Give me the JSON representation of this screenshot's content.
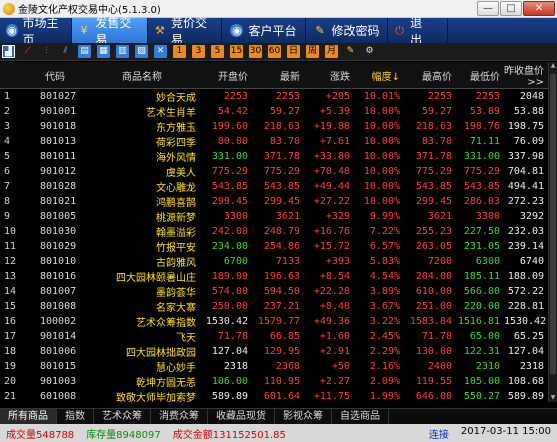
{
  "window": {
    "title": "金陵文化产权交易中心(5.1.3.0)",
    "minimize": "—",
    "maximize": "□",
    "close": "✕"
  },
  "nav": {
    "home": "市场主页",
    "sell": "发售交易",
    "bid": "竞价交易",
    "client": "客户平台",
    "password": "修改密码",
    "exit": "退　出"
  },
  "toolbar": {
    "buttons": [
      "K线",
      "分时",
      "排序",
      "报表",
      "成交",
      "委托",
      "明细",
      "行情",
      "资讯",
      "成交量",
      "委买",
      "委卖",
      "F10",
      "F11",
      "F12",
      "设置"
    ]
  },
  "table": {
    "headers": [
      "",
      "代码",
      "商品名称",
      "开盘价",
      "最新",
      "涨跌",
      "幅度↓",
      "最高价",
      "最低价",
      "昨收盘价 >>"
    ],
    "selected_row": 25,
    "rows": [
      [
        "1",
        "801027",
        "妙合天成",
        "2253",
        "2253",
        "+205",
        "10.01%",
        "2253",
        "2253",
        "2048"
      ],
      [
        "2",
        "901001",
        "艺术生肖羊",
        "54.42",
        "59.27",
        "+5.39",
        "10.00%",
        "59.27",
        "53.89",
        "53.88"
      ],
      [
        "3",
        "901018",
        "东方雅玉",
        "199.60",
        "218.63",
        "+19.88",
        "10.00%",
        "218.63",
        "198.76",
        "198.75"
      ],
      [
        "4",
        "801013",
        "荷彩四季",
        "80.00",
        "83.70",
        "+7.61",
        "10.00%",
        "83.70",
        "71.11",
        "76.09"
      ],
      [
        "5",
        "801011",
        "海外风情",
        "331.00",
        "371.78",
        "+33.80",
        "10.00%",
        "371.78",
        "331.00",
        "337.98"
      ],
      [
        "6",
        "901012",
        "虞美人",
        "775.29",
        "775.29",
        "+70.48",
        "10.00%",
        "775.29",
        "775.29",
        "704.81"
      ],
      [
        "7",
        "801028",
        "文心雕龙",
        "543.85",
        "543.85",
        "+49.44",
        "10.00%",
        "543.85",
        "543.85",
        "494.41"
      ],
      [
        "8",
        "801021",
        "鸿鹏喜鹊",
        "299.45",
        "299.45",
        "+27.22",
        "10.00%",
        "299.45",
        "286.03",
        "272.23"
      ],
      [
        "9",
        "801005",
        "桃源新梦",
        "3300",
        "3621",
        "+329",
        "9.99%",
        "3621",
        "3300",
        "3292"
      ],
      [
        "10",
        "801030",
        "翰墨溢彩",
        "242.00",
        "248.79",
        "+16.76",
        "7.22%",
        "255.23",
        "227.50",
        "232.03"
      ],
      [
        "11",
        "801029",
        "竹报平安",
        "234.00",
        "254.86",
        "+15.72",
        "6.57%",
        "263.05",
        "231.05",
        "239.14"
      ],
      [
        "12",
        "801010",
        "古韵雅风",
        "6700",
        "7133",
        "+393",
        "5.83%",
        "7200",
        "6300",
        "6740"
      ],
      [
        "13",
        "801016",
        "四大园林颐暑山庄",
        "189.09",
        "196.63",
        "+8.54",
        "4.54%",
        "204.00",
        "185.11",
        "188.09"
      ],
      [
        "14",
        "801007",
        "墨韵荟华",
        "574.00",
        "594.50",
        "+22.28",
        "3.89%",
        "610.00",
        "566.00",
        "572.22"
      ],
      [
        "15",
        "801008",
        "名家大寨",
        "250.00",
        "237.21",
        "+8.40",
        "3.67%",
        "251.00",
        "220.00",
        "228.81"
      ],
      [
        "16",
        "100002",
        "艺术众筹指数",
        "1530.42",
        "1579.77",
        "+49.36",
        "3.22%",
        "1583.84",
        "1516.81",
        "1530.42"
      ],
      [
        "17",
        "901014",
        "飞天",
        "71.78",
        "66.85",
        "+1.60",
        "2.45%",
        "71.78",
        "65.00",
        "65.25"
      ],
      [
        "18",
        "801006",
        "四大园林拙政园",
        "127.04",
        "129.95",
        "+2.91",
        "2.29%",
        "130.00",
        "122.31",
        "127.04"
      ],
      [
        "19",
        "801015",
        "慧心妙手",
        "2318",
        "2368",
        "+50",
        "2.16%",
        "2400",
        "2310",
        "2318"
      ],
      [
        "20",
        "901003",
        "乾坤方圆无恙",
        "106.00",
        "110.95",
        "+2.27",
        "2.09%",
        "119.55",
        "105.00",
        "108.68"
      ],
      [
        "21",
        "601008",
        "致敬大师毕加索梦",
        "589.89",
        "601.64",
        "+11.75",
        "1.99%",
        "646.00",
        "550.27",
        "589.89"
      ],
      [
        "22",
        "801001",
        "秋山云起",
        "169.00",
        "172.22",
        "+3.34",
        "1.98%",
        "174.99",
        "169.00",
        "168.88"
      ],
      [
        "23",
        "100001",
        "综合指数",
        "1359.25",
        "1386.10",
        "+26.85",
        "1.98%",
        "1388.66",
        "1352.41",
        "1359.25"
      ],
      [
        "24",
        "801017",
        "心是一块田",
        "77.98",
        "81.10",
        "+1.52",
        "1.91%",
        "87.00",
        "77.98",
        "79.58"
      ],
      [
        "25",
        "901008",
        "茗壶秋月当梅韵",
        "194.00",
        "199.34",
        "+3.18",
        "1.62%",
        "209.90",
        "194.00",
        "196.16"
      ]
    ]
  },
  "tabs": [
    "所有商品",
    "指数",
    "艺术众筹",
    "消费众筹",
    "收藏品现货",
    "影视众筹",
    "自选商品"
  ],
  "status": {
    "volume": "成交量548788",
    "stock": "库存量8948097",
    "amount": "成交金额131152501.85",
    "connection": "连接",
    "time": "2017-03-11 15:00"
  },
  "colors": {
    "up": "#ff3b3b",
    "down": "#2fdc2f",
    "name": "#ffe000",
    "nav_active": "#3a88e8",
    "selected_row": "#2e5aa8"
  }
}
